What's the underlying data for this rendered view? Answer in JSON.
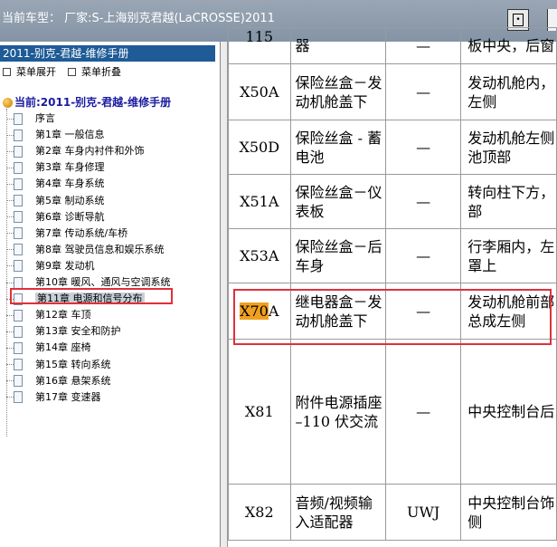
{
  "titlebar": {
    "text": "当前车型：  厂家:S-上海别克君越(LaCROSSE)2011"
  },
  "left": {
    "manual_title": "2011-别克-君越-维修手册",
    "expand_label": "菜单展开",
    "collapse_label": "菜单折叠",
    "root_label": "当前:2011-别克-君越-维修手册",
    "items": [
      {
        "label": "序言"
      },
      {
        "label": "第1章 一般信息"
      },
      {
        "label": "第2章 车身内衬件和外饰"
      },
      {
        "label": "第3章 车身修理"
      },
      {
        "label": "第4章 车身系统"
      },
      {
        "label": "第5章 制动系统"
      },
      {
        "label": "第6章 诊断导航"
      },
      {
        "label": "第7章 传动系统/车桥"
      },
      {
        "label": "第8章 驾驶员信息和娱乐系统"
      },
      {
        "label": "第9章 发动机"
      },
      {
        "label": "第10章 暖风、通风与空调系统"
      },
      {
        "label": "第11章 电源和信号分布"
      },
      {
        "label": "第12章 车顶"
      },
      {
        "label": "第13章 安全和防护"
      },
      {
        "label": "第14章 座椅"
      },
      {
        "label": "第15章 转向系统"
      },
      {
        "label": "第16章 悬架系统"
      },
      {
        "label": "第17章 变速器"
      }
    ],
    "selected_index": 11
  },
  "table": {
    "rows": [
      {
        "code_a": "115",
        "code_b": "",
        "desc": "器",
        "wire": "—",
        "loc": "板中央，后窗"
      },
      {
        "code_a": "X50A",
        "code_b": "",
        "desc": "保险丝盒－发动机舱盖下",
        "wire": "—",
        "loc": "发动机舱内，左侧"
      },
      {
        "code_a": "X50D",
        "code_b": "",
        "desc": "保险丝盒 - 蓄电池",
        "wire": "—",
        "loc": "发动机舱左侧池顶部"
      },
      {
        "code_a": "X51A",
        "code_b": "",
        "desc": "保险丝盒－仪表板",
        "wire": "—",
        "loc": "转向柱下方，部"
      },
      {
        "code_a": "X53A",
        "code_b": "",
        "desc": "保险丝盒－后车身",
        "wire": "—",
        "loc": "行李厢内，左罩上"
      },
      {
        "code_a": "X70",
        "code_b": "A",
        "desc": "继电器盒－发动机舱盖下",
        "wire": "—",
        "loc": "发动机舱前部总成左侧"
      },
      {
        "code_a": "X81",
        "code_b": "",
        "desc": "附件电源插座 –110 伏交流",
        "wire": "—",
        "loc": "中央控制台后"
      },
      {
        "code_a": "X82",
        "code_b": "",
        "desc": "音频/视频输入适配器",
        "wire": "UWJ",
        "loc": "中央控制台饰侧"
      }
    ]
  },
  "colors": {
    "title_bar": "#8f9cad",
    "manual_bar": "#1e5b97",
    "highlight": "#f0a020",
    "red_box": "#e0303a"
  }
}
